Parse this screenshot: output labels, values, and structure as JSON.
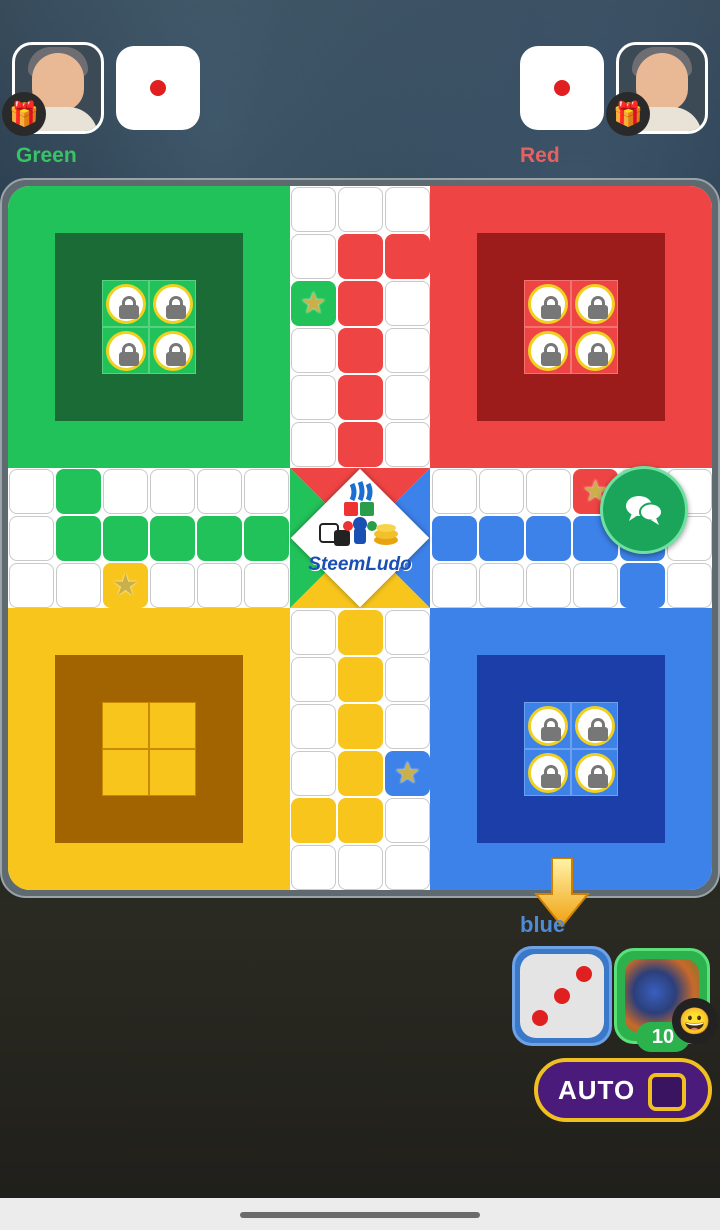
{
  "players": {
    "top_left": {
      "name": "Green",
      "name_color": "#39c463",
      "dice_value": 1
    },
    "top_right": {
      "name": "Red",
      "name_color": "#e04b4b",
      "dice_value": 1
    },
    "bottom_right": {
      "name": "blue",
      "dice_value": 3,
      "score": "10"
    }
  },
  "board": {
    "colors": {
      "green": "#22c25a",
      "green_inner": "#1b6b37",
      "red": "#ef4444",
      "red_inner": "#9c1c1c",
      "yellow": "#f7c51c",
      "yellow_inner": "#a16400",
      "blue": "#3c82e8",
      "blue_inner": "#1c3ea8"
    },
    "logo_text": "SteemLudo",
    "locked_tokens": {
      "green": 4,
      "red": 4,
      "blue": 4,
      "yellow": 0
    }
  },
  "controls": {
    "auto_label": "AUTO",
    "chat_icon": "chat-bubbles-icon",
    "emoji_icon": "smiley-icon",
    "gift_icon": "gift-icon"
  }
}
